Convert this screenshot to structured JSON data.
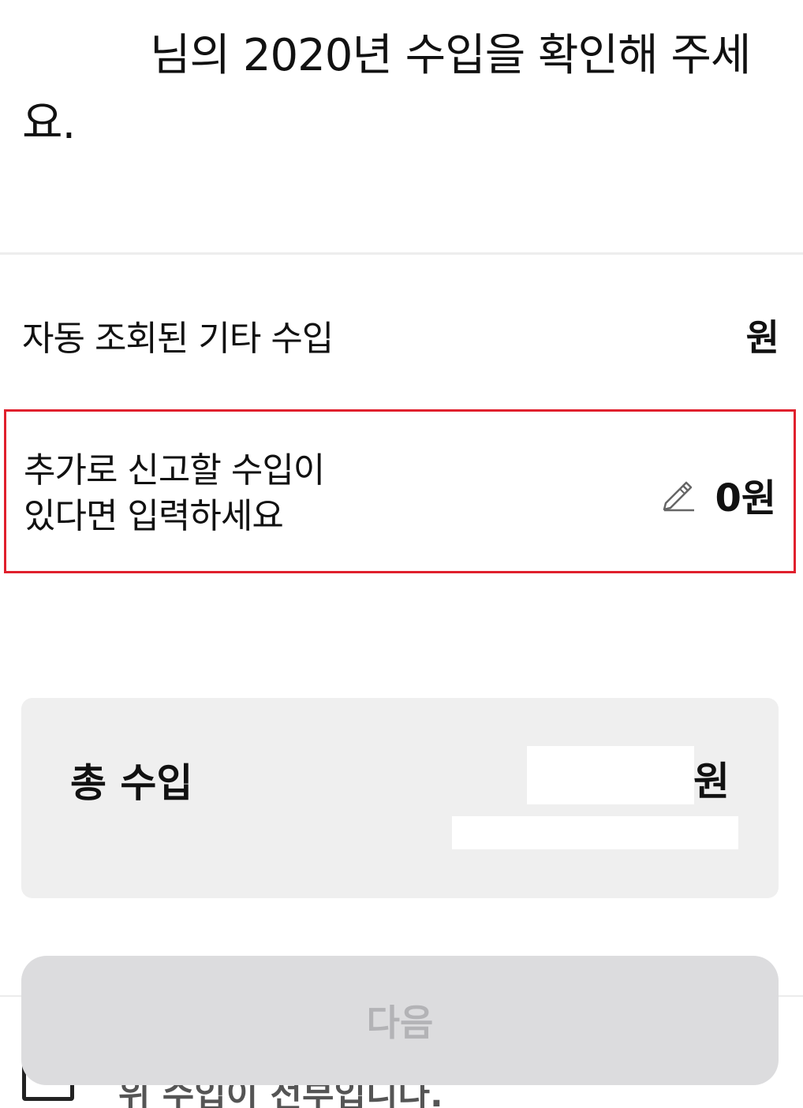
{
  "heading": {
    "line": "님의 2020년 수입을 확인해 주세요."
  },
  "auto_income": {
    "label": "자동 조회된 기타 수입",
    "amount": "원"
  },
  "extra_income": {
    "label_line1": "추가로 신고할 수입이",
    "label_line2": "있다면 입력하세요",
    "icon": "pencil-icon",
    "amount": "0원"
  },
  "total": {
    "label": "총 수입",
    "unit": "원"
  },
  "footer": {
    "confirm_text": "위 수입이 전부입니다.",
    "next_label": "다음"
  },
  "colors": {
    "highlight_border": "#e0202d",
    "card_background": "#efefef",
    "button_background": "#dcdcde",
    "button_text": "#b3b3b6"
  }
}
